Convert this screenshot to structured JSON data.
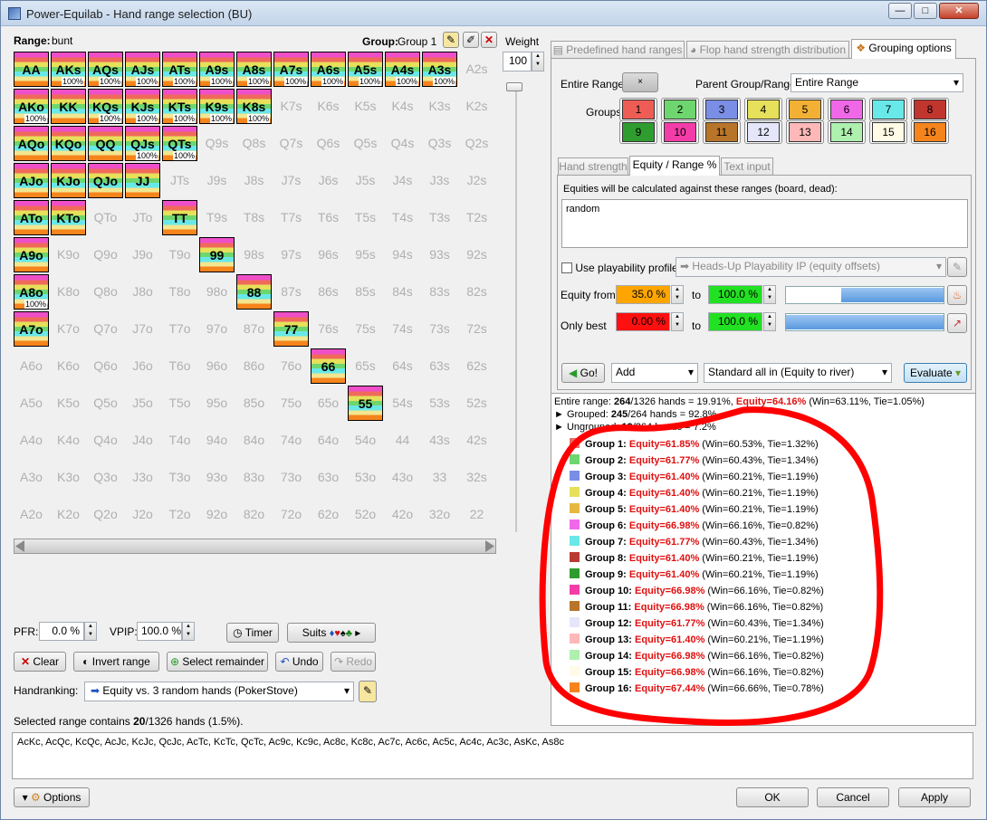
{
  "window": {
    "title": "Power-Equilab - Hand range selection (BU)"
  },
  "left": {
    "range_label": "Range:",
    "range_value": "bunt",
    "group_label": "Group:",
    "group_value": "Group 1",
    "weight_label": "Weight",
    "weight_value": "100"
  },
  "grid": [
    [
      "AA",
      "AKs",
      "AQs",
      "AJs",
      "ATs",
      "A9s",
      "A8s",
      "A7s",
      "A6s",
      "A5s",
      "A4s",
      "A3s",
      "A2s"
    ],
    [
      "AKo",
      "KK",
      "KQs",
      "KJs",
      "KTs",
      "K9s",
      "K8s",
      "K7s",
      "K6s",
      "K5s",
      "K4s",
      "K3s",
      "K2s"
    ],
    [
      "AQo",
      "KQo",
      "QQ",
      "QJs",
      "QTs",
      "Q9s",
      "Q8s",
      "Q7s",
      "Q6s",
      "Q5s",
      "Q4s",
      "Q3s",
      "Q2s"
    ],
    [
      "AJo",
      "KJo",
      "QJo",
      "JJ",
      "JTs",
      "J9s",
      "J8s",
      "J7s",
      "J6s",
      "J5s",
      "J4s",
      "J3s",
      "J2s"
    ],
    [
      "ATo",
      "KTo",
      "QTo",
      "JTo",
      "TT",
      "T9s",
      "T8s",
      "T7s",
      "T6s",
      "T5s",
      "T4s",
      "T3s",
      "T2s"
    ],
    [
      "A9o",
      "K9o",
      "Q9o",
      "J9o",
      "T9o",
      "99",
      "98s",
      "97s",
      "96s",
      "95s",
      "94s",
      "93s",
      "92s"
    ],
    [
      "A8o",
      "K8o",
      "Q8o",
      "J8o",
      "T8o",
      "98o",
      "88",
      "87s",
      "86s",
      "85s",
      "84s",
      "83s",
      "82s"
    ],
    [
      "A7o",
      "K7o",
      "Q7o",
      "J7o",
      "T7o",
      "97o",
      "87o",
      "77",
      "76s",
      "75s",
      "74s",
      "73s",
      "72s"
    ],
    [
      "A6o",
      "K6o",
      "Q6o",
      "J6o",
      "T6o",
      "96o",
      "86o",
      "76o",
      "66",
      "65s",
      "64s",
      "63s",
      "62s"
    ],
    [
      "A5o",
      "K5o",
      "Q5o",
      "J5o",
      "T5o",
      "95o",
      "85o",
      "75o",
      "65o",
      "55",
      "54s",
      "53s",
      "52s"
    ],
    [
      "A4o",
      "K4o",
      "Q4o",
      "J4o",
      "T4o",
      "94o",
      "84o",
      "74o",
      "64o",
      "54o",
      "44",
      "43s",
      "42s"
    ],
    [
      "A3o",
      "K3o",
      "Q3o",
      "J3o",
      "T3o",
      "93o",
      "83o",
      "73o",
      "63o",
      "53o",
      "43o",
      "33",
      "32s"
    ],
    [
      "A2o",
      "K2o",
      "Q2o",
      "J2o",
      "T2o",
      "92o",
      "82o",
      "72o",
      "62o",
      "52o",
      "42o",
      "32o",
      "22"
    ]
  ],
  "selected_hands": {
    "AA": "",
    "AKs": "100%",
    "AQs": "100%",
    "AJs": "100%",
    "ATs": "100%",
    "A9s": "100%",
    "A8s": "100%",
    "A7s": "100%",
    "A6s": "100%",
    "A5s": "100%",
    "A4s": "100%",
    "A3s": "100%",
    "AKo": "100%",
    "KK": "",
    "KQs": "100%",
    "KJs": "100%",
    "KTs": "100%",
    "K9s": "100%",
    "K8s": "100%",
    "AQo": "",
    "KQo": "",
    "QQ": "",
    "QJs": "100%",
    "QTs": "100%",
    "AJo": "",
    "KJo": "",
    "QJo": "",
    "JJ": "",
    "ATo": "",
    "KTo": "",
    "TT": "",
    "A9o": "",
    "99": "",
    "A8o": "100%",
    "88": "",
    "A7o": "",
    "77": "",
    "66": "",
    "55": ""
  },
  "controls": {
    "pfr_label": "PFR:",
    "pfr_value": "0.0 %",
    "vpip_label": "VPIP:",
    "vpip_value": "100.0 %",
    "timer": "Timer",
    "suits": "Suits",
    "clear": "Clear",
    "invert": "Invert range",
    "select_remainder": "Select remainder",
    "undo": "Undo",
    "redo": "Redo",
    "handranking_label": "Handranking:",
    "handranking_value": "Equity vs. 3 random hands (PokerStove)",
    "summary_prefix": "Selected range contains ",
    "summary_count": "20",
    "summary_suffix": "/1326 hands (1.5%).",
    "combos": "AcKc, AcQc, KcQc, AcJc, KcJc, QcJc, AcTc, KcTc, QcTc, Ac9c, Kc9c, Ac8c, Kc8c, Ac7c, Ac6c, Ac5c, Ac4c, Ac3c, AsKc, As8c"
  },
  "tabs": {
    "predefined": "Predefined hand ranges",
    "flop": "Flop hand strength distribution",
    "grouping": "Grouping options"
  },
  "grouping": {
    "entire_range_label": "Entire Range:",
    "entire_range_btn": "×",
    "parent_label": "Parent Group/Range:",
    "parent_value": "Entire Range",
    "groups_label": "Groups:",
    "group_buttons": [
      {
        "n": "1",
        "c": "#ee5d55"
      },
      {
        "n": "2",
        "c": "#6ed66e"
      },
      {
        "n": "3",
        "c": "#7a8ee6"
      },
      {
        "n": "4",
        "c": "#e6e05a"
      },
      {
        "n": "5",
        "c": "#f2b035"
      },
      {
        "n": "6",
        "c": "#f068e8"
      },
      {
        "n": "7",
        "c": "#68e8e8"
      },
      {
        "n": "8",
        "c": "#c0362e"
      },
      {
        "n": "9",
        "c": "#2f9c2f"
      },
      {
        "n": "10",
        "c": "#f43ca8"
      },
      {
        "n": "11",
        "c": "#b8752a"
      },
      {
        "n": "12",
        "c": "#e6e6fa"
      },
      {
        "n": "13",
        "c": "#ffb8b8"
      },
      {
        "n": "14",
        "c": "#aef0ae"
      },
      {
        "n": "15",
        "c": "#fffbe6"
      },
      {
        "n": "16",
        "c": "#f6841c"
      }
    ]
  },
  "subtabs": {
    "hand_strength": "Hand strength",
    "equity": "Equity / Range %",
    "text_input": "Text input"
  },
  "equity": {
    "against_label": "Equities will be calculated against these ranges (board, dead):",
    "against_value": "random",
    "playability_label": "Use playability profile:",
    "playability_value": "Heads-Up Playability IP  (equity offsets)",
    "equity_from_label": "Equity from",
    "equity_from": "35.0 %",
    "to1": "to",
    "equity_to": "100.0 %",
    "only_best_label": "Only best",
    "only_best_from": "0.00 %",
    "to2": "to",
    "only_best_to": "100.0 %",
    "equity_slider_low": 0.35,
    "equity_slider_high": 1.0,
    "best_slider_low": 0.0,
    "best_slider_high": 1.0,
    "go": "Go!",
    "mode": "Add",
    "calc": "Standard all in (Equity to river)",
    "evaluate": "Evaluate"
  },
  "results": {
    "entire_prefix": "Entire range: ",
    "entire_count": "264",
    "entire_mid": "/1326 hands = 19.91%, ",
    "entire_eq": "Equity=64.16%",
    "entire_rest": " (Win=63.11%, Tie=1.05%)",
    "grouped_prefix": "► Grouped: ",
    "grouped_count": "245",
    "grouped_rest": "/264 hands = 92.8%",
    "ungrouped_prefix": "► Ungrouped: ",
    "ungrouped_count": "19",
    "ungrouped_rest": "/264 hands = 7.2%",
    "groups": [
      {
        "name": "Group 1:",
        "eq": "Equity=61.85%",
        "rest": " (Win=60.53%, Tie=1.32%)",
        "color": "#ee6a62"
      },
      {
        "name": "Group 2:",
        "eq": "Equity=61.77%",
        "rest": " (Win=60.43%, Tie=1.34%)",
        "color": "#6ed66e"
      },
      {
        "name": "Group 3:",
        "eq": "Equity=61.40%",
        "rest": " (Win=60.21%, Tie=1.19%)",
        "color": "#7a8ee6"
      },
      {
        "name": "Group 4:",
        "eq": "Equity=61.40%",
        "rest": " (Win=60.21%, Tie=1.19%)",
        "color": "#e6e05a"
      },
      {
        "name": "Group 5:",
        "eq": "Equity=61.40%",
        "rest": " (Win=60.21%, Tie=1.19%)",
        "color": "#e6b840"
      },
      {
        "name": "Group 6:",
        "eq": "Equity=66.98%",
        "rest": " (Win=66.16%, Tie=0.82%)",
        "color": "#f068e8"
      },
      {
        "name": "Group 7:",
        "eq": "Equity=61.77%",
        "rest": " (Win=60.43%, Tie=1.34%)",
        "color": "#68e8e8"
      },
      {
        "name": "Group 8:",
        "eq": "Equity=61.40%",
        "rest": " (Win=60.21%, Tie=1.19%)",
        "color": "#b83a32"
      },
      {
        "name": "Group 9:",
        "eq": "Equity=61.40%",
        "rest": " (Win=60.21%, Tie=1.19%)",
        "color": "#2f9c2f"
      },
      {
        "name": "Group 10:",
        "eq": "Equity=66.98%",
        "rest": " (Win=66.16%, Tie=0.82%)",
        "color": "#f43ca8"
      },
      {
        "name": "Group 11:",
        "eq": "Equity=66.98%",
        "rest": " (Win=66.16%, Tie=0.82%)",
        "color": "#b8752a"
      },
      {
        "name": "Group 12:",
        "eq": "Equity=61.77%",
        "rest": " (Win=60.43%, Tie=1.34%)",
        "color": "#e6e6fa"
      },
      {
        "name": "Group 13:",
        "eq": "Equity=61.40%",
        "rest": " (Win=60.21%, Tie=1.19%)",
        "color": "#ffb8b8"
      },
      {
        "name": "Group 14:",
        "eq": "Equity=66.98%",
        "rest": " (Win=66.16%, Tie=0.82%)",
        "color": "#aef0ae"
      },
      {
        "name": "Group 15:",
        "eq": "Equity=66.98%",
        "rest": " (Win=66.16%, Tie=0.82%)",
        "color": "#fffbe6"
      },
      {
        "name": "Group 16:",
        "eq": "Equity=67.44%",
        "rest": " (Win=66.66%, Tie=0.78%)",
        "color": "#f6841c"
      }
    ]
  },
  "bottom": {
    "options": "Options",
    "ok": "OK",
    "cancel": "Cancel",
    "apply": "Apply"
  }
}
